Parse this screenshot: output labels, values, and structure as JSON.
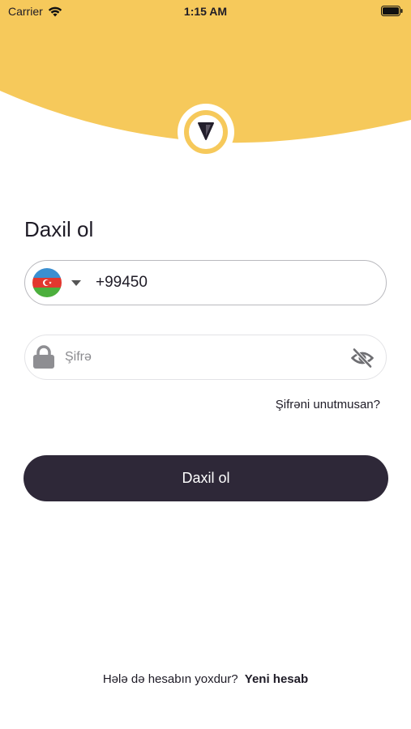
{
  "status_bar": {
    "carrier": "Carrier",
    "time": "1:15 AM"
  },
  "header": {
    "background_color": "#f6c95b",
    "logo_icon": "navigation-arrow-icon"
  },
  "login": {
    "title": "Daxil ol",
    "phone": {
      "country_flag": "azerbaijan-flag-icon",
      "value": "+99450"
    },
    "password": {
      "placeholder": "Şifrə",
      "toggle_icon": "eye-off-icon"
    },
    "forgot_password": "Şifrəni unutmusan?",
    "submit_label": "Daxil ol"
  },
  "footer": {
    "question": "Hələ də hesabın yoxdur?",
    "signup_link": "Yeni hesab"
  },
  "colors": {
    "accent": "#f6c95b",
    "button": "#2e2838",
    "text": "#1e1b26"
  }
}
